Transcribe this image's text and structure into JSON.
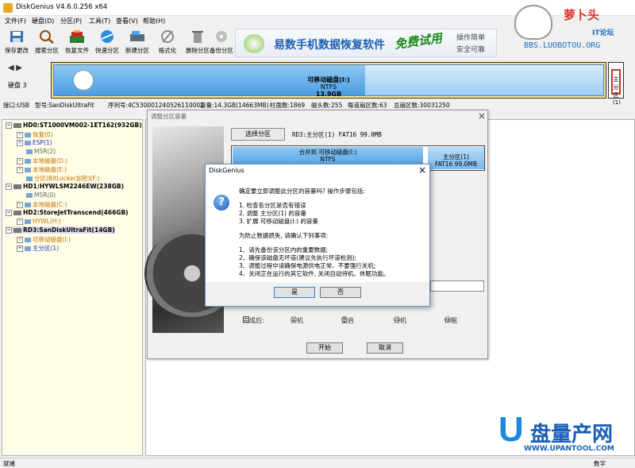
{
  "window": {
    "title": "DiskGenius V4.6.0.256 x64"
  },
  "menu": [
    "文件(F)",
    "硬盘(D)",
    "分区(P)",
    "工具(T)",
    "查看(V)",
    "帮助(H)"
  ],
  "toolbar": [
    {
      "label": "保存更改",
      "icon": "save-icon"
    },
    {
      "label": "搜索分区",
      "icon": "search-icon"
    },
    {
      "label": "恢复文件",
      "icon": "recover-icon"
    },
    {
      "label": "快速分区",
      "icon": "quick-partition-icon"
    },
    {
      "label": "新建分区",
      "icon": "new-partition-icon"
    },
    {
      "label": "格式化",
      "icon": "format-icon"
    },
    {
      "label": "删除分区",
      "icon": "delete-icon"
    },
    {
      "label": "备份分区",
      "icon": "backup-icon"
    }
  ],
  "ad": {
    "text": "易数手机数据恢复软件",
    "badge": "免费试用",
    "line1": "操作简单",
    "line2": "安全可靠"
  },
  "logo": {
    "main": "萝卜头",
    "sub": "IT论坛",
    "url": "BBS.LUOBOTOU.ORG"
  },
  "disk": {
    "label": "硬盘 3",
    "partition_name": "可移动磁盘(I:)",
    "fs": "NTFS",
    "size": "13.9GB",
    "small": "主分\n区(1)"
  },
  "info": {
    "interface": "接口:USB",
    "model": "型号:SanDiskUltraFit",
    "serial": "序列号:4C530001240526110002",
    "capacity": "容量:14.3GB(14663MB)",
    "cylinders": "柱面数:1869",
    "heads": "磁头数:255",
    "sectors": "每道扇区数:63",
    "total": "总扇区数:30031250"
  },
  "tree": [
    {
      "text": "HD0:ST1000VM002-1ET162(932GB)",
      "level": 0,
      "cls": "c-bold"
    },
    {
      "text": "恢复(0)",
      "level": 2,
      "cls": "c-orange"
    },
    {
      "text": "ESP(1)",
      "level": 2,
      "cls": "c-blue"
    },
    {
      "text": "MSR(2)",
      "level": 2,
      "cls": "c-gray"
    },
    {
      "text": "本地磁盘(D:)",
      "level": 2,
      "cls": "c-orange"
    },
    {
      "text": "本地磁盘(E:)",
      "level": 2,
      "cls": "c-orange"
    },
    {
      "text": "分区(BitLocker加密)(F:)",
      "level": 2,
      "cls": "c-orange"
    },
    {
      "text": "HD1:HYWLSM2246EW(238GB)",
      "level": 0,
      "cls": "c-bold"
    },
    {
      "text": "MSR(0)",
      "level": 2,
      "cls": "c-gray"
    },
    {
      "text": "本地磁盘(C:)",
      "level": 2,
      "cls": "c-orange"
    },
    {
      "text": "HD2:StoreJetTranscend(466GB)",
      "level": 0,
      "cls": "c-bold"
    },
    {
      "text": "HYWL(H:)",
      "level": 2,
      "cls": "c-orange"
    },
    {
      "text": "RD3:SanDiskUltraFit(14GB)",
      "level": 0,
      "cls": "c-bold sel"
    },
    {
      "text": "可移动磁盘(I:)",
      "level": 2,
      "cls": "c-orange"
    },
    {
      "text": "主分区(1)",
      "level": 2,
      "cls": "c-blue"
    }
  ],
  "back_dialog": {
    "title": "调整分区容量",
    "select_btn": "选择分区",
    "selected": "RD3:主分区(1) FAT16 99.0MB",
    "merge_text": "合并到 可移动磁盘(I:)",
    "merge_fs": "NTFS",
    "part2_name": "主分区(1)",
    "part2_info": "FAT16 99.0MB",
    "after_done": "完成后:",
    "options": [
      "关机",
      "重启",
      "待机",
      "休眠"
    ],
    "start": "开始",
    "cancel": "取消"
  },
  "front_dialog": {
    "title": "DiskGenius",
    "q": "确定要立即调整此分区的容量吗? 操作步骤包括:",
    "steps": [
      "1.  检查各分区是否有错误",
      "2.  调整 主分区(1) 的容量",
      "3.  扩展 可移动磁盘(I:) 的容量"
    ],
    "warn": "为防止数据损失, 请确认下列事项:",
    "items": [
      "1、请先备份该分区内的重要数据;",
      "2、确保该磁盘无坏道(建议先执行坏道检测);",
      "3、调整过程中请确保电源供电正常、不要强行关机;",
      "4、关闭正在运行的其它软件, 关闭自动待机、休眠功能。"
    ],
    "yes": "是",
    "no": "否"
  },
  "watermark": {
    "u": "U",
    "cn": "盘量产网",
    "url": "WWW.UPANTOOL.COM"
  },
  "status": {
    "left": "就绪",
    "right": "数字"
  }
}
